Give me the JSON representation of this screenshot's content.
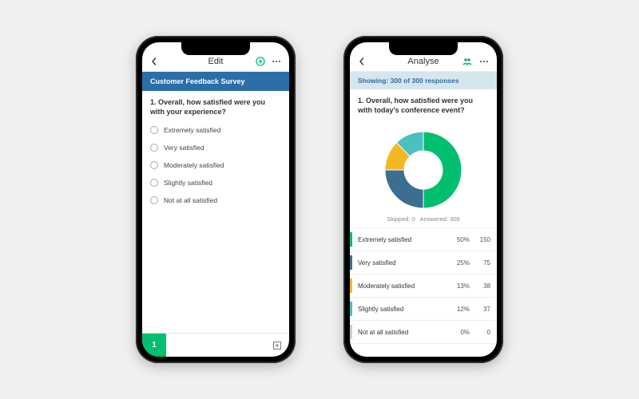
{
  "phone_edit": {
    "title": "Edit",
    "survey_title": "Customer Feedback Survey",
    "question": "1. Overall, how satisfied were you with your experience?",
    "options": [
      "Extremely satisfied",
      "Very satisfied",
      "Moderately satisfied",
      "Slightly satisfied",
      "Not at all satisfied"
    ],
    "page_number": "1"
  },
  "phone_analyse": {
    "title": "Analyse",
    "showing": "Showing: 300 of 300 responses",
    "question": "1. Overall, how satisfied were you with today's conference event?",
    "skipped_label": "Skipped: 0",
    "answered_label": "Answered: 300",
    "legend": [
      {
        "label": "Extremely satisfied",
        "pct": "50%",
        "count": "150",
        "color": "#00bf6f"
      },
      {
        "label": "Very satisfied",
        "pct": "25%",
        "count": "75",
        "color": "#3b6e8f"
      },
      {
        "label": "Moderately satisfied",
        "pct": "13%",
        "count": "38",
        "color": "#f2b824"
      },
      {
        "label": "Slightly satisfied",
        "pct": "12%",
        "count": "37",
        "color": "#4ac0c0"
      },
      {
        "label": "Not at all satisfied",
        "pct": "0%",
        "count": "0",
        "color": "#cccccc"
      }
    ]
  },
  "chart_data": {
    "type": "pie",
    "title": "",
    "categories": [
      "Extremely satisfied",
      "Very satisfied",
      "Moderately satisfied",
      "Slightly satisfied",
      "Not at all satisfied"
    ],
    "values": [
      150,
      75,
      38,
      37,
      0
    ],
    "colors": [
      "#00bf6f",
      "#3b6e8f",
      "#f2b824",
      "#4ac0c0",
      "#cccccc"
    ],
    "total": 300
  },
  "colors": {
    "brand_blue": "#2b6ea8",
    "brand_green": "#00bf6f"
  }
}
